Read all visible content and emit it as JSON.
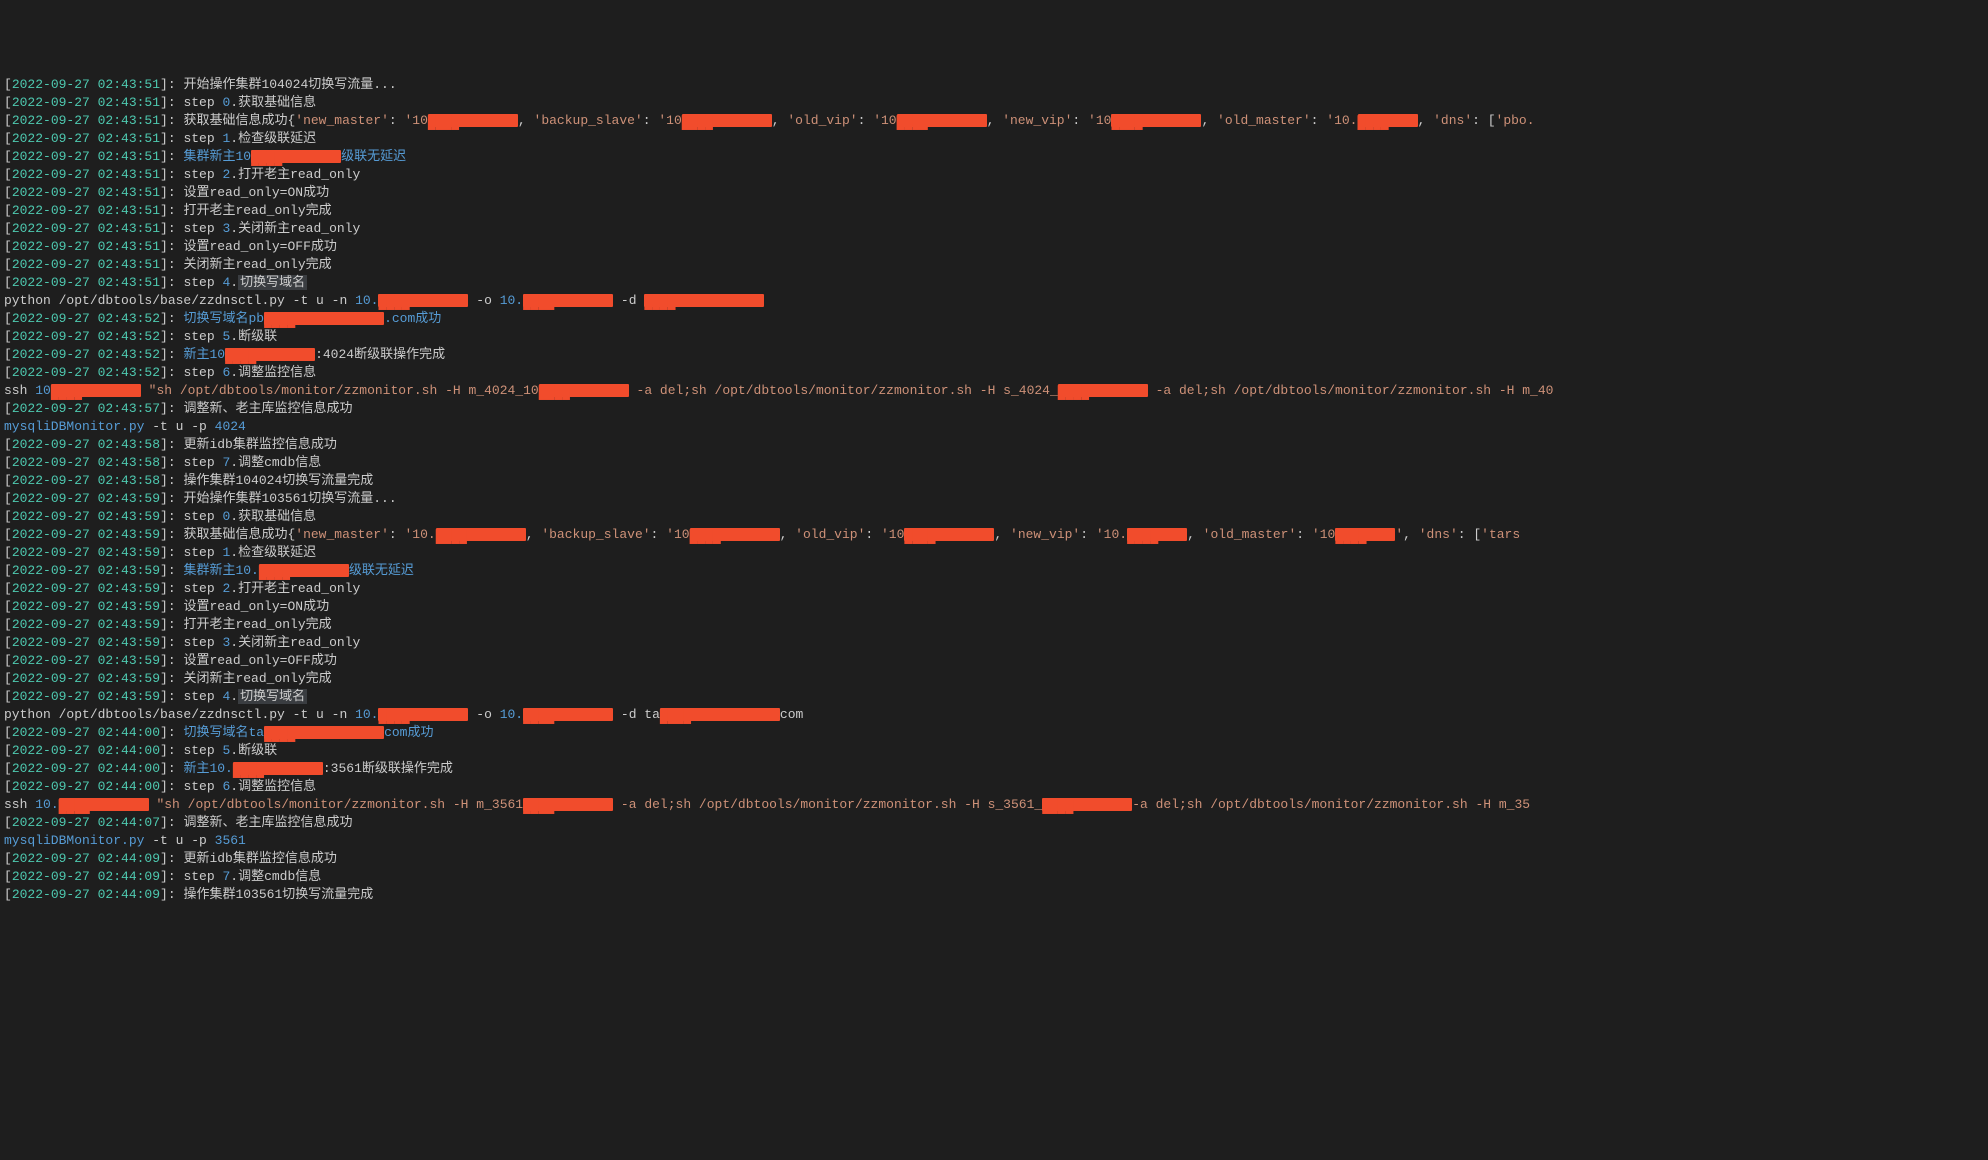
{
  "lines": [
    {
      "ts": "2022-09-27 02:43:51",
      "segs": [
        {
          "c": "white",
          "t": "开始操作集群104024切换写流量..."
        }
      ]
    },
    {
      "ts": "2022-09-27 02:43:51",
      "segs": [
        {
          "c": "white",
          "t": "step "
        },
        {
          "c": "blue",
          "t": "0"
        },
        {
          "c": "white",
          "t": ".获取基础信息"
        }
      ]
    },
    {
      "ts": "2022-09-27 02:43:51",
      "segs": [
        {
          "c": "white",
          "t": "获取基础信息成功{"
        },
        {
          "c": "orange",
          "t": "'new_master'"
        },
        {
          "c": "white",
          "t": ": "
        },
        {
          "c": "orange",
          "t": "'10"
        },
        {
          "redact": "r-md"
        },
        {
          "c": "white",
          "t": ", "
        },
        {
          "c": "orange",
          "t": "'backup_slave'"
        },
        {
          "c": "white",
          "t": ": "
        },
        {
          "c": "orange",
          "t": "'10"
        },
        {
          "redact": "r-md"
        },
        {
          "c": "white",
          "t": ", "
        },
        {
          "c": "orange",
          "t": "'old_vip'"
        },
        {
          "c": "white",
          "t": ": "
        },
        {
          "c": "orange",
          "t": "'10"
        },
        {
          "redact": "r-md"
        },
        {
          "c": "white",
          "t": ", "
        },
        {
          "c": "orange",
          "t": "'new_vip'"
        },
        {
          "c": "white",
          "t": ": "
        },
        {
          "c": "orange",
          "t": "'10"
        },
        {
          "redact": "r-md"
        },
        {
          "c": "white",
          "t": ", "
        },
        {
          "c": "orange",
          "t": "'old_master'"
        },
        {
          "c": "white",
          "t": ": "
        },
        {
          "c": "orange",
          "t": "'10."
        },
        {
          "redact": "r-sm"
        },
        {
          "c": "white",
          "t": ", "
        },
        {
          "c": "orange",
          "t": "'dns'"
        },
        {
          "c": "white",
          "t": ": ["
        },
        {
          "c": "orange",
          "t": "'pbo."
        }
      ]
    },
    {
      "ts": "2022-09-27 02:43:51",
      "segs": [
        {
          "c": "white",
          "t": "step "
        },
        {
          "c": "blue",
          "t": "1"
        },
        {
          "c": "white",
          "t": ".检查级联延迟"
        }
      ]
    },
    {
      "ts": "2022-09-27 02:43:51",
      "segs": [
        {
          "c": "blue",
          "t": "集群新主10"
        },
        {
          "redact": "r-md"
        },
        {
          "c": "blue",
          "t": "级联无延迟"
        }
      ]
    },
    {
      "ts": "2022-09-27 02:43:51",
      "segs": [
        {
          "c": "white",
          "t": "step "
        },
        {
          "c": "blue",
          "t": "2"
        },
        {
          "c": "white",
          "t": ".打开老主read_only"
        }
      ]
    },
    {
      "ts": "2022-09-27 02:43:51",
      "segs": [
        {
          "c": "white",
          "t": "设置read_only=ON成功"
        }
      ]
    },
    {
      "ts": "2022-09-27 02:43:51",
      "segs": [
        {
          "c": "white",
          "t": "打开老主read_only完成"
        }
      ]
    },
    {
      "ts": "2022-09-27 02:43:51",
      "segs": [
        {
          "c": "white",
          "t": "step "
        },
        {
          "c": "blue",
          "t": "3"
        },
        {
          "c": "white",
          "t": ".关闭新主read_only"
        }
      ]
    },
    {
      "ts": "2022-09-27 02:43:51",
      "segs": [
        {
          "c": "white",
          "t": "设置read_only=OFF成功"
        }
      ]
    },
    {
      "ts": "2022-09-27 02:43:51",
      "segs": [
        {
          "c": "white",
          "t": "关闭新主read_only完成"
        }
      ]
    },
    {
      "ts": "2022-09-27 02:43:51",
      "segs": [
        {
          "c": "white",
          "t": "step "
        },
        {
          "c": "blue",
          "t": "4"
        },
        {
          "c": "white",
          "t": "."
        },
        {
          "c": "white",
          "t": "切换写域名",
          "hl": true
        }
      ]
    },
    {
      "raw": true,
      "segs": [
        {
          "c": "white",
          "t": "python /opt/dbtools/base/zzdnsctl.py -t u -n "
        },
        {
          "c": "blue",
          "t": "10."
        },
        {
          "redact": "r-md"
        },
        {
          "c": "white",
          "t": " -o "
        },
        {
          "c": "blue",
          "t": "10."
        },
        {
          "redact": "r-md"
        },
        {
          "c": "white",
          "t": " -d "
        },
        {
          "redact": "r-lg"
        }
      ]
    },
    {
      "ts": "2022-09-27 02:43:52",
      "segs": [
        {
          "c": "blue",
          "t": "切换写域名pb"
        },
        {
          "redact": "r-lg"
        },
        {
          "c": "blue",
          "t": ".com成功"
        }
      ]
    },
    {
      "ts": "2022-09-27 02:43:52",
      "segs": [
        {
          "c": "white",
          "t": "step "
        },
        {
          "c": "blue",
          "t": "5"
        },
        {
          "c": "white",
          "t": ".断级联"
        }
      ]
    },
    {
      "ts": "2022-09-27 02:43:52",
      "segs": [
        {
          "c": "blue",
          "t": "新主10"
        },
        {
          "redact": "r-md"
        },
        {
          "c": "white",
          "t": ":4024断级联操作完成"
        }
      ]
    },
    {
      "ts": "2022-09-27 02:43:52",
      "segs": [
        {
          "c": "white",
          "t": "step "
        },
        {
          "c": "blue",
          "t": "6"
        },
        {
          "c": "white",
          "t": ".调整监控信息"
        }
      ]
    },
    {
      "raw": true,
      "segs": [
        {
          "c": "white",
          "t": "ssh "
        },
        {
          "c": "blue",
          "t": "10"
        },
        {
          "redact": "r-md"
        },
        {
          "c": "white",
          "t": " "
        },
        {
          "c": "orange",
          "t": "\"sh /opt/dbtools/monitor/zzmonitor.sh -H m_4024_10"
        },
        {
          "redact": "r-md"
        },
        {
          "c": "orange",
          "t": " -a del;sh /opt/dbtools/monitor/zzmonitor.sh -H s_4024_"
        },
        {
          "redact": "r-md"
        },
        {
          "c": "orange",
          "t": " -a del;sh /opt/dbtools/monitor/zzmonitor.sh -H m_40"
        }
      ]
    },
    {
      "ts": "2022-09-27 02:43:57",
      "segs": [
        {
          "c": "white",
          "t": "调整新、老主库监控信息成功"
        }
      ]
    },
    {
      "raw": true,
      "segs": [
        {
          "c": "blue",
          "t": "mysqliDBMonitor.py"
        },
        {
          "c": "white",
          "t": " -t u -p "
        },
        {
          "c": "blue",
          "t": "4024"
        }
      ]
    },
    {
      "ts": "2022-09-27 02:43:58",
      "segs": [
        {
          "c": "white",
          "t": "更新idb集群监控信息成功"
        }
      ]
    },
    {
      "ts": "2022-09-27 02:43:58",
      "segs": [
        {
          "c": "white",
          "t": "step "
        },
        {
          "c": "blue",
          "t": "7"
        },
        {
          "c": "white",
          "t": ".调整cmdb信息"
        }
      ]
    },
    {
      "ts": "2022-09-27 02:43:58",
      "segs": [
        {
          "c": "white",
          "t": "操作集群104024切换写流量完成"
        }
      ]
    },
    {
      "ts": "2022-09-27 02:43:59",
      "segs": [
        {
          "c": "white",
          "t": "开始操作集群103561切换写流量..."
        }
      ]
    },
    {
      "ts": "2022-09-27 02:43:59",
      "segs": [
        {
          "c": "white",
          "t": "step "
        },
        {
          "c": "blue",
          "t": "0"
        },
        {
          "c": "white",
          "t": ".获取基础信息"
        }
      ]
    },
    {
      "ts": "2022-09-27 02:43:59",
      "segs": [
        {
          "c": "white",
          "t": "获取基础信息成功{"
        },
        {
          "c": "orange",
          "t": "'new_master'"
        },
        {
          "c": "white",
          "t": ": "
        },
        {
          "c": "orange",
          "t": "'10."
        },
        {
          "redact": "r-md"
        },
        {
          "c": "white",
          "t": ", "
        },
        {
          "c": "orange",
          "t": "'backup_slave'"
        },
        {
          "c": "white",
          "t": ": "
        },
        {
          "c": "orange",
          "t": "'10"
        },
        {
          "redact": "r-md"
        },
        {
          "c": "white",
          "t": ", "
        },
        {
          "c": "orange",
          "t": "'old_vip'"
        },
        {
          "c": "white",
          "t": ": "
        },
        {
          "c": "orange",
          "t": "'10"
        },
        {
          "redact": "r-md"
        },
        {
          "c": "white",
          "t": ", "
        },
        {
          "c": "orange",
          "t": "'new_vip'"
        },
        {
          "c": "white",
          "t": ": "
        },
        {
          "c": "orange",
          "t": "'10."
        },
        {
          "redact": "r-sm"
        },
        {
          "c": "white",
          "t": ", "
        },
        {
          "c": "orange",
          "t": "'old_master'"
        },
        {
          "c": "white",
          "t": ": "
        },
        {
          "c": "orange",
          "t": "'10"
        },
        {
          "redact": "r-sm"
        },
        {
          "c": "orange",
          "t": "'"
        },
        {
          "c": "white",
          "t": ", "
        },
        {
          "c": "orange",
          "t": "'dns'"
        },
        {
          "c": "white",
          "t": ": ["
        },
        {
          "c": "orange",
          "t": "'tars"
        }
      ]
    },
    {
      "ts": "2022-09-27 02:43:59",
      "segs": [
        {
          "c": "white",
          "t": "step "
        },
        {
          "c": "blue",
          "t": "1"
        },
        {
          "c": "white",
          "t": ".检查级联延迟"
        }
      ]
    },
    {
      "ts": "2022-09-27 02:43:59",
      "segs": [
        {
          "c": "blue",
          "t": "集群新主10."
        },
        {
          "redact": "r-md"
        },
        {
          "c": "blue",
          "t": "级联无延迟"
        }
      ]
    },
    {
      "ts": "2022-09-27 02:43:59",
      "segs": [
        {
          "c": "white",
          "t": "step "
        },
        {
          "c": "blue",
          "t": "2"
        },
        {
          "c": "white",
          "t": ".打开老主read_only"
        }
      ]
    },
    {
      "ts": "2022-09-27 02:43:59",
      "segs": [
        {
          "c": "white",
          "t": "设置read_only=ON成功"
        }
      ]
    },
    {
      "ts": "2022-09-27 02:43:59",
      "segs": [
        {
          "c": "white",
          "t": "打开老主read_only完成"
        }
      ]
    },
    {
      "ts": "2022-09-27 02:43:59",
      "segs": [
        {
          "c": "white",
          "t": "step "
        },
        {
          "c": "blue",
          "t": "3"
        },
        {
          "c": "white",
          "t": ".关闭新主read_only"
        }
      ]
    },
    {
      "ts": "2022-09-27 02:43:59",
      "segs": [
        {
          "c": "white",
          "t": "设置read_only=OFF成功"
        }
      ]
    },
    {
      "ts": "2022-09-27 02:43:59",
      "segs": [
        {
          "c": "white",
          "t": "关闭新主read_only完成"
        }
      ]
    },
    {
      "ts": "2022-09-27 02:43:59",
      "segs": [
        {
          "c": "white",
          "t": "step "
        },
        {
          "c": "blue",
          "t": "4"
        },
        {
          "c": "white",
          "t": "."
        },
        {
          "c": "white",
          "t": "切换写域名",
          "hl": true
        }
      ]
    },
    {
      "raw": true,
      "segs": [
        {
          "c": "white",
          "t": "python /opt/dbtools/base/zzdnsctl.py -t u -n "
        },
        {
          "c": "blue",
          "t": "10."
        },
        {
          "redact": "r-md"
        },
        {
          "c": "white",
          "t": " -o "
        },
        {
          "c": "blue",
          "t": "10."
        },
        {
          "redact": "r-md"
        },
        {
          "c": "white",
          "t": " -d ta"
        },
        {
          "redact": "r-lg"
        },
        {
          "c": "white",
          "t": "com"
        }
      ]
    },
    {
      "ts": "2022-09-27 02:44:00",
      "segs": [
        {
          "c": "blue",
          "t": "切换写域名ta"
        },
        {
          "redact": "r-lg"
        },
        {
          "c": "blue",
          "t": "com成功"
        }
      ]
    },
    {
      "ts": "2022-09-27 02:44:00",
      "segs": [
        {
          "c": "white",
          "t": "step "
        },
        {
          "c": "blue",
          "t": "5"
        },
        {
          "c": "white",
          "t": ".断级联"
        }
      ]
    },
    {
      "ts": "2022-09-27 02:44:00",
      "segs": [
        {
          "c": "blue",
          "t": "新主10."
        },
        {
          "redact": "r-md"
        },
        {
          "c": "white",
          "t": ":3561断级联操作完成"
        }
      ]
    },
    {
      "ts": "2022-09-27 02:44:00",
      "segs": [
        {
          "c": "white",
          "t": "step "
        },
        {
          "c": "blue",
          "t": "6"
        },
        {
          "c": "white",
          "t": ".调整监控信息"
        }
      ]
    },
    {
      "raw": true,
      "segs": [
        {
          "c": "white",
          "t": "ssh "
        },
        {
          "c": "blue",
          "t": "10."
        },
        {
          "redact": "r-md"
        },
        {
          "c": "white",
          "t": " "
        },
        {
          "c": "orange",
          "t": "\"sh /opt/dbtools/monitor/zzmonitor.sh -H m_3561"
        },
        {
          "redact": "r-md"
        },
        {
          "c": "orange",
          "t": " -a del;sh /opt/dbtools/monitor/zzmonitor.sh -H s_3561_"
        },
        {
          "redact": "r-md"
        },
        {
          "c": "orange",
          "t": "-a del;sh /opt/dbtools/monitor/zzmonitor.sh -H m_35"
        }
      ]
    },
    {
      "ts": "2022-09-27 02:44:07",
      "segs": [
        {
          "c": "white",
          "t": "调整新、老主库监控信息成功"
        }
      ]
    },
    {
      "raw": true,
      "segs": [
        {
          "c": "blue",
          "t": "mysqliDBMonitor.py"
        },
        {
          "c": "white",
          "t": " -t u -p "
        },
        {
          "c": "blue",
          "t": "3561"
        }
      ]
    },
    {
      "ts": "2022-09-27 02:44:09",
      "segs": [
        {
          "c": "white",
          "t": "更新idb集群监控信息成功"
        }
      ]
    },
    {
      "ts": "2022-09-27 02:44:09",
      "segs": [
        {
          "c": "white",
          "t": "step "
        },
        {
          "c": "blue",
          "t": "7"
        },
        {
          "c": "white",
          "t": ".调整cmdb信息"
        }
      ]
    },
    {
      "ts": "2022-09-27 02:44:09",
      "segs": [
        {
          "c": "white",
          "t": "操作集群103561切换写流量完成"
        }
      ]
    }
  ]
}
